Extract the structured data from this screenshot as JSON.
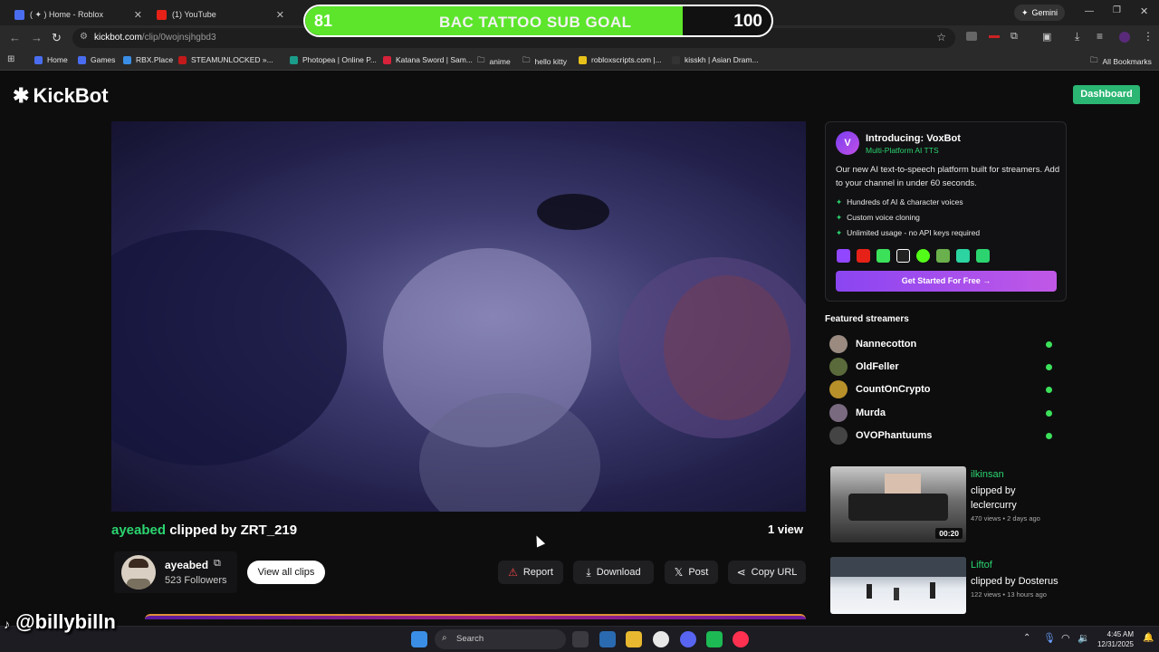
{
  "browser": {
    "tabs": [
      {
        "label": "( ✦ ) Home - Roblox"
      },
      {
        "label": "(1) YouTube"
      }
    ],
    "url_host": "kickbot.com",
    "url_path": "/clip/0wojnsjhgbd3",
    "gemini_label": "Gemini",
    "bookmarks": [
      "Home",
      "Games",
      "RBX.Place",
      "STEAMUNLOCKED »...",
      "Photopea | Online P...",
      "Katana Sword | Sam...",
      "anime",
      "hello kitty",
      "robloxscripts.com |...",
      "kisskh | Asian Dram..."
    ],
    "all_bookmarks": "All Bookmarks"
  },
  "goal_overlay": {
    "current": "81",
    "title": "BAC TATTOO SUB GOAL",
    "max": "100",
    "progress": 0.81
  },
  "header": {
    "logo": "KickBot",
    "dashboard": "Dashboard"
  },
  "clip": {
    "channel": "ayeabed",
    "clipped_by_text": "clipped by ZRT_219",
    "views": "1 view",
    "creator_name": "ayeabed",
    "followers": "523 Followers",
    "view_all": "View all clips",
    "actions": {
      "report": "Report",
      "download": "Download",
      "post": "Post",
      "copy_url": "Copy URL"
    }
  },
  "promo": {
    "avatar": "V",
    "title": "Introducing: VoxBot",
    "subtitle": "Multi-Platform AI TTS",
    "description": "Our new AI text-to-speech platform built for streamers. Add to your channel in under 60 seconds.",
    "features": [
      "Hundreds of AI & character voices",
      "Custom voice cloning",
      "Unlimited usage - no API keys required"
    ],
    "cta": "Get Started For Free →"
  },
  "featured": {
    "title": "Featured streamers",
    "streamers": [
      "Nannecotton",
      "OldFeller",
      "CountOnCrypto",
      "Murda",
      "OVOPhantuums"
    ]
  },
  "related_clips": [
    {
      "channel": "ilkinsan",
      "clipped_by": "clipped by leclercurry",
      "meta": "470 views • 2 days ago",
      "duration": "00:20"
    },
    {
      "channel": "Liftof",
      "clipped_by": "clipped by Dosterus",
      "meta": "122 views • 13 hours ago",
      "duration": ""
    }
  ],
  "overlay_handle": "@billybilln",
  "taskbar": {
    "search": "Search",
    "time": "4:45 AM",
    "date": "12/31/2025"
  },
  "colors": {
    "accent_green": "#2bd46f",
    "goal_green": "#5ce52b",
    "promo_purple": "#8a45f2"
  }
}
